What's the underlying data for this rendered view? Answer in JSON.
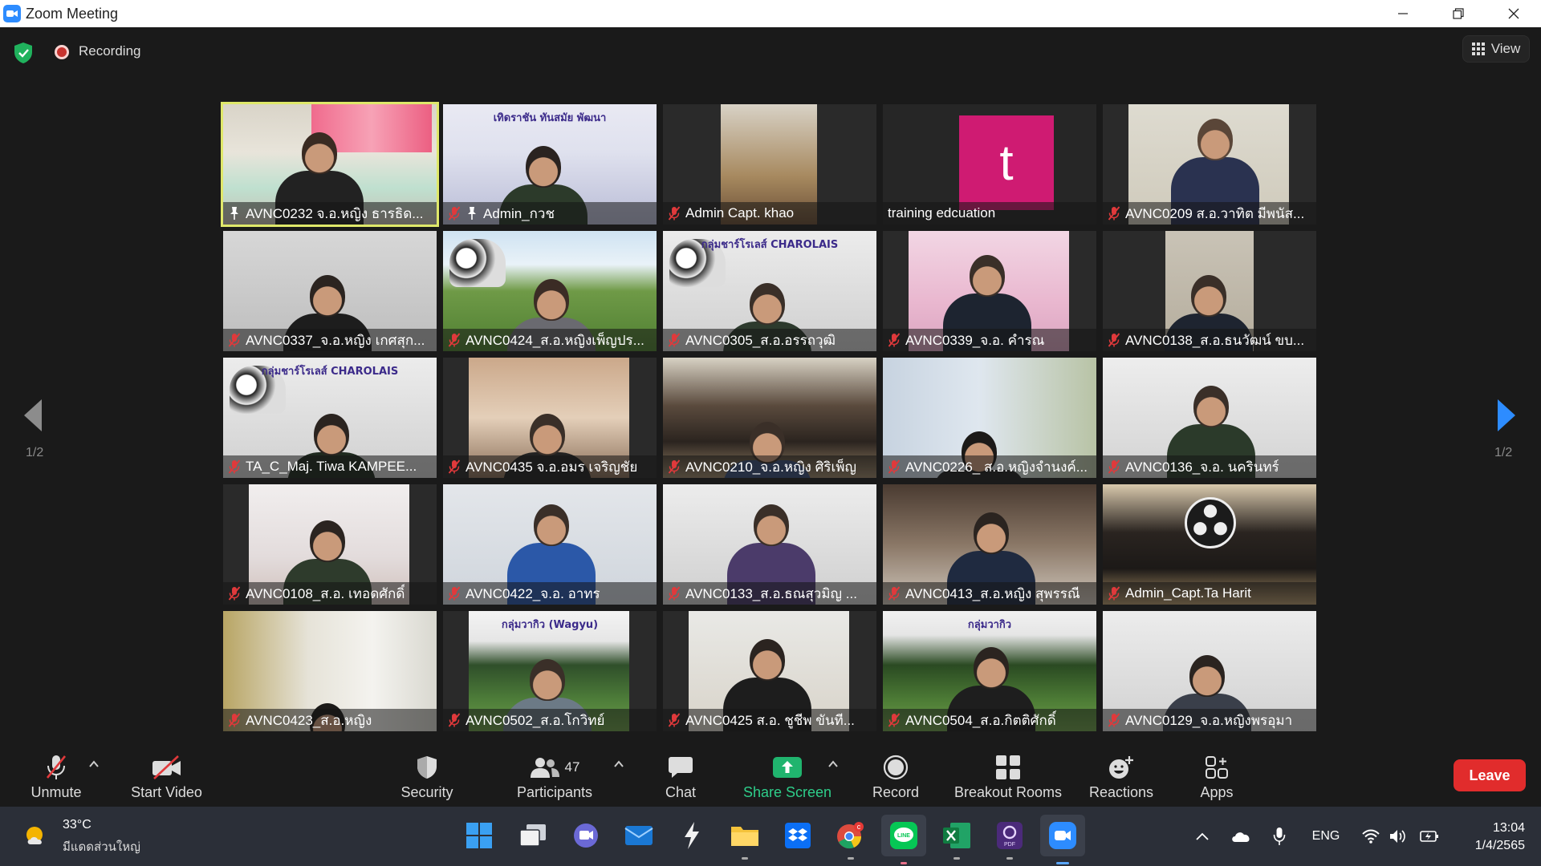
{
  "window": {
    "title": "Zoom Meeting"
  },
  "header": {
    "recording_label": "Recording",
    "view_label": "View"
  },
  "pagination": {
    "left": "1/2",
    "right": "1/2"
  },
  "tiles": [
    {
      "name": "AVNC0232 จ.อ.หญิง ธารธิด...",
      "muted": false,
      "pinned": true,
      "active": true
    },
    {
      "name": "Admin_กวช",
      "muted": true,
      "pinned": true,
      "banner": "เทิดราชัน   ทันสมัย   พัฒนา"
    },
    {
      "name": "Admin Capt. khao",
      "muted": true
    },
    {
      "name": "training edcuation",
      "muted": false,
      "avatar_letter": "t"
    },
    {
      "name": "AVNC0209 ส.อ.วาทิต มีพนัส...",
      "muted": true
    },
    {
      "name": "AVNC0337_จ.อ.หญิง เกศสุก...",
      "muted": true
    },
    {
      "name": "AVNC0424_ส.อ.หญิงเพ็ญปร...",
      "muted": true
    },
    {
      "name": "AVNC0305_ส.อ.อรรถวุฒิ",
      "muted": true,
      "banner": "กลุ่มชาร์โรเลส์ CHAROLAIS"
    },
    {
      "name": "AVNC0339_จ.อ. คำรณ",
      "muted": true
    },
    {
      "name": "AVNC0138_ส.อ.ธนวัฒน์ ขบ...",
      "muted": true
    },
    {
      "name": "TA_C_Maj. Tiwa KAMPEE...",
      "muted": true,
      "banner": "กลุ่มชาร์โรเลส์ CHAROLAIS"
    },
    {
      "name": "AVNC0435 จ.อ.อมร เจริญชัย",
      "muted": true
    },
    {
      "name": "AVNC0210_จ.อ.หญิง ศิริเพ็ญ",
      "muted": true
    },
    {
      "name": "AVNC0226_ ส.อ.หญิงจำนงค์...",
      "muted": true
    },
    {
      "name": "AVNC0136_จ.อ. นครินทร์",
      "muted": true
    },
    {
      "name": "AVNC0108_ส.อ. เทอดศักดิ์",
      "muted": true
    },
    {
      "name": "AVNC0422_จ.อ. อาทร",
      "muted": true
    },
    {
      "name": "AVNC0133_ส.อ.ธณสุวมิญ ...",
      "muted": true
    },
    {
      "name": "AVNC0413_ส.อ.หญิง สุพรรณี",
      "muted": true
    },
    {
      "name": "Admin_Capt.Ta Harit",
      "muted": true
    },
    {
      "name": "AVNC0423_ส.อ.หญิง",
      "muted": true
    },
    {
      "name": "AVNC0502_ส.อ.โกวิทย์",
      "muted": true,
      "banner": "กลุ่มวากิว (Wagyu)"
    },
    {
      "name": "AVNC0425 ส.อ. ชูชีพ  ขันที...",
      "muted": true
    },
    {
      "name": "AVNC0504_ส.อ.กิตติศักดิ์",
      "muted": true,
      "banner": "กลุ่มวากิว"
    },
    {
      "name": "AVNC0129_จ.อ.หญิงพรอุมา",
      "muted": true
    }
  ],
  "toolbar": {
    "unmute": "Unmute",
    "start_video": "Start Video",
    "security": "Security",
    "participants": "Participants",
    "participants_count": "47",
    "chat": "Chat",
    "share_screen": "Share Screen",
    "record": "Record",
    "breakout_rooms": "Breakout Rooms",
    "reactions": "Reactions",
    "apps": "Apps",
    "leave": "Leave"
  },
  "taskbar": {
    "weather_temp": "33°C",
    "weather_desc": "มีแดดส่วนใหญ่",
    "language": "ENG",
    "time": "13:04",
    "date": "1/4/2565",
    "chrome_badge": "c"
  },
  "colors": {
    "accent_blue": "#2d8cff",
    "share_green": "#2ece8a",
    "leave_red": "#e12c2c",
    "active_speaker": "#dfe86a",
    "mute_red": "#e0393b"
  }
}
